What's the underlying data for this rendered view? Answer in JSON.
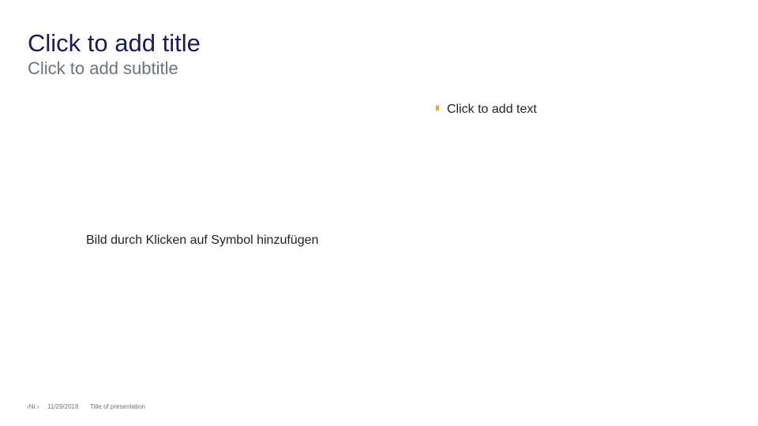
{
  "slide": {
    "title": "Click to add title",
    "subtitle": "Click to add subtitle",
    "text_placeholder": "Click to add text",
    "picture_placeholder": "Bild durch Klicken auf Symbol hinzufügen",
    "accent_color": "#f5a623",
    "title_color": "#1a1a5e"
  },
  "footer": {
    "slide_number": "‹Nr.›",
    "date": "11/29/2018",
    "presentation_title": "Title of presentation"
  }
}
